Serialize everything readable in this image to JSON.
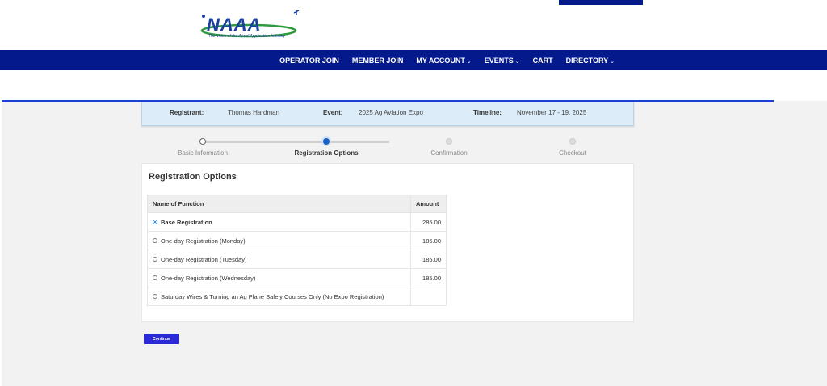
{
  "header": {
    "logo_text": "NAAA",
    "logo_tagline": "The Voice of the Aerial Application Industry"
  },
  "nav": {
    "items": [
      {
        "label": "OPERATOR JOIN",
        "dropdown": false
      },
      {
        "label": "MEMBER JOIN",
        "dropdown": false
      },
      {
        "label": "MY ACCOUNT",
        "dropdown": true
      },
      {
        "label": "EVENTS",
        "dropdown": true
      },
      {
        "label": "CART",
        "dropdown": false
      },
      {
        "label": "DIRECTORY",
        "dropdown": true
      }
    ]
  },
  "registration": {
    "registrant_label": "Registrant:",
    "registrant_value": "Thomas Hardman",
    "event_label": "Event:",
    "event_value": "2025 Ag Aviation Expo",
    "timeline_label": "Timeline:",
    "timeline_value": "November 17 - 19, 2025"
  },
  "steps": [
    {
      "label": "Basic Information",
      "state": "completed"
    },
    {
      "label": "Registration Options",
      "state": "active"
    },
    {
      "label": "Confirmation",
      "state": "pending"
    },
    {
      "label": "Checkout",
      "state": "pending"
    }
  ],
  "panel": {
    "title": "Registration Options",
    "table": {
      "headers": [
        "Name of Function",
        "Amount"
      ],
      "rows": [
        {
          "name": "Base Registration",
          "amount": "285.00",
          "selected": true
        },
        {
          "name": "One-day Registration (Monday)",
          "amount": "185.00",
          "selected": false
        },
        {
          "name": "One-day Registration (Tuesday)",
          "amount": "185.00",
          "selected": false
        },
        {
          "name": "One-day Registration (Wednesday)",
          "amount": "185.00",
          "selected": false
        },
        {
          "name": "Saturday Wires & Turning an Ag Plane Safely Courses Only (No Expo Registration)",
          "amount": "",
          "selected": false
        }
      ]
    }
  },
  "continue_label": "Continue",
  "colors": {
    "navbar": "#041a8c",
    "accent": "#1a62c6",
    "button": "#2a2ad6",
    "info_bg": "#dcedf9"
  }
}
